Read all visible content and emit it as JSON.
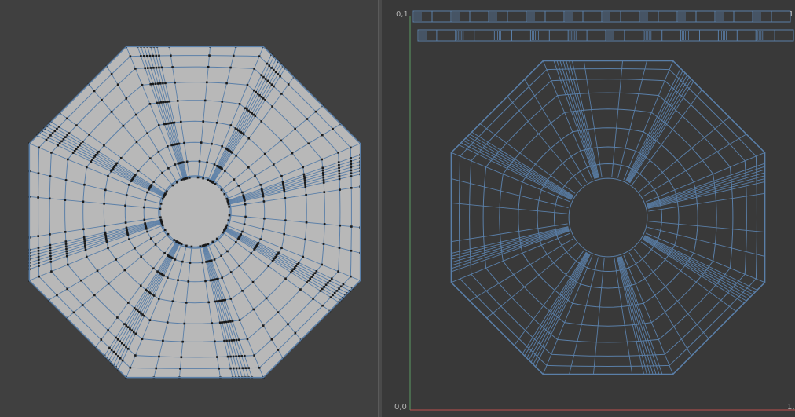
{
  "colors": {
    "background": "#404040",
    "uv_background": "#393939",
    "face_fill": "#b8b8b8",
    "edge": "#5a7fa8",
    "vertex": "#1a1a1a",
    "axis_u": "#c0504d",
    "axis_v": "#5a9a63"
  },
  "uv_axes": {
    "origin_label": "0,0",
    "v_max_label": "0,1",
    "u_max_label": "1,",
    "top_right_label": "1"
  }
}
